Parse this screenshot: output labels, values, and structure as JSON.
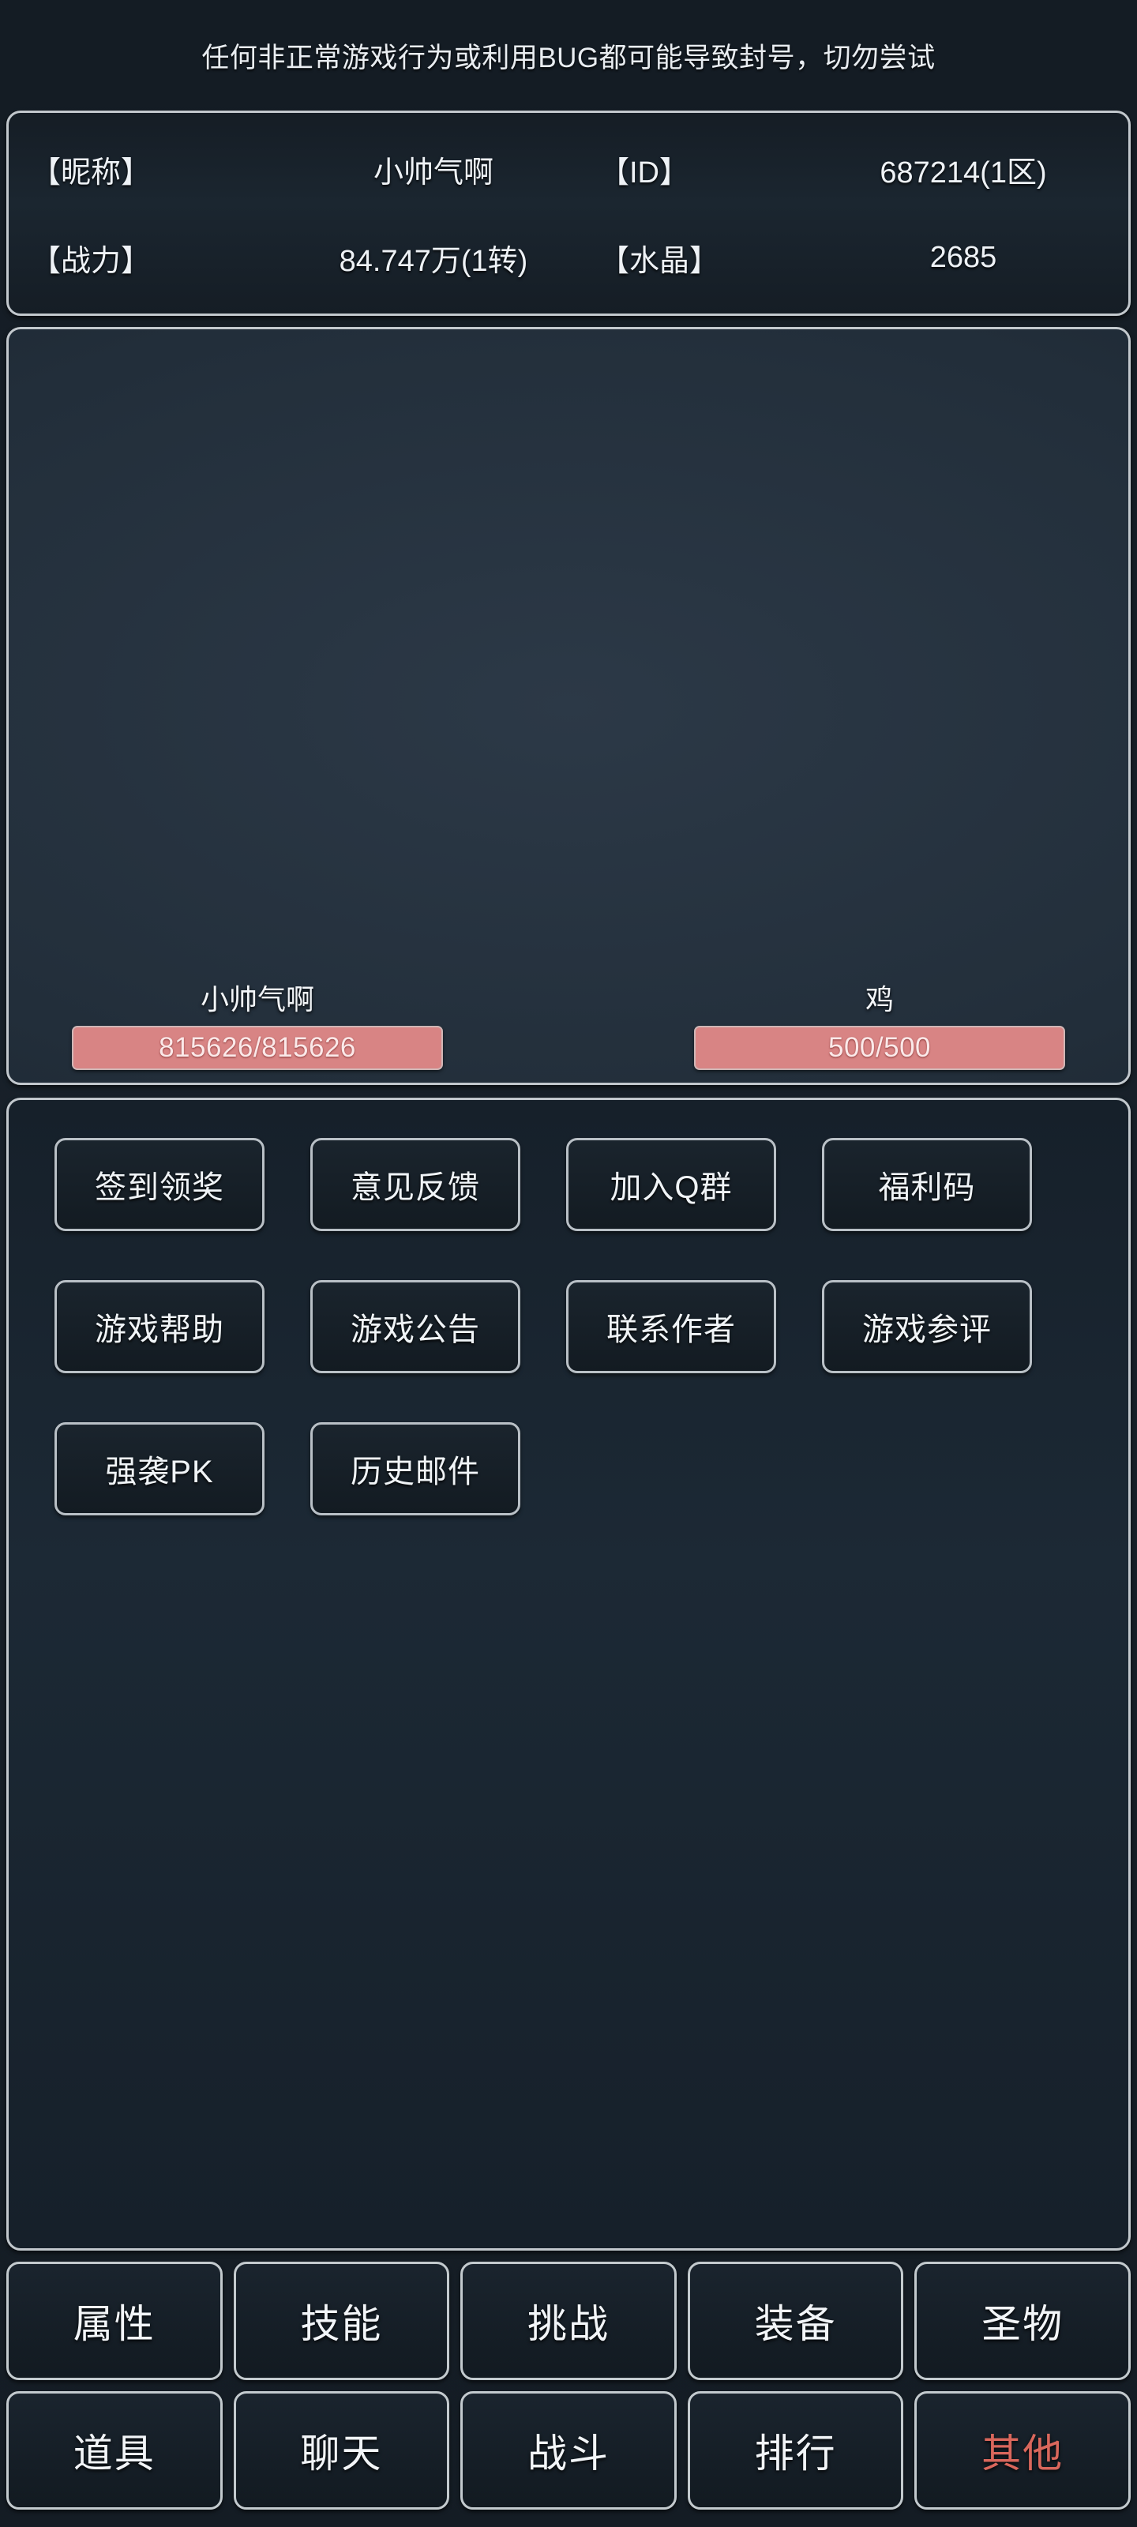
{
  "warning": {
    "text": "任何非正常游戏行为或利用BUG都可能导致封号，切勿尝试"
  },
  "player_stats": {
    "rows": [
      {
        "label_left": "【昵称】",
        "value_left": "小帅气啊",
        "label_right": "【ID】",
        "value_right": "687214(1区)"
      },
      {
        "label_left": "【战力】",
        "value_left": "84.747万(1转)",
        "label_right": "【水晶】",
        "value_right": "2685"
      }
    ]
  },
  "battle": {
    "player": {
      "name": "小帅气啊",
      "hp_text": "815626/815626",
      "hp_current": 815626,
      "hp_max": 815626,
      "hp_percent": 100
    },
    "enemy": {
      "name": "鸡",
      "hp_text": "500/500",
      "hp_current": 500,
      "hp_max": 500,
      "hp_percent": 100
    },
    "hp_bar_color": "#d88484"
  },
  "menu": {
    "buttons": [
      {
        "label": "签到领奖"
      },
      {
        "label": "意见反馈"
      },
      {
        "label": "加入Q群"
      },
      {
        "label": "福利码"
      },
      {
        "label": "游戏帮助"
      },
      {
        "label": "游戏公告"
      },
      {
        "label": "联系作者"
      },
      {
        "label": "游戏参评"
      },
      {
        "label": "强袭PK"
      },
      {
        "label": "历史邮件"
      }
    ]
  },
  "bottom_nav": {
    "active_color": "#d9675c",
    "rows": [
      [
        {
          "label": "属性",
          "active": false
        },
        {
          "label": "技能",
          "active": false
        },
        {
          "label": "挑战",
          "active": false
        },
        {
          "label": "装备",
          "active": false
        },
        {
          "label": "圣物",
          "active": false
        }
      ],
      [
        {
          "label": "道具",
          "active": false
        },
        {
          "label": "聊天",
          "active": false
        },
        {
          "label": "战斗",
          "active": false
        },
        {
          "label": "排行",
          "active": false
        },
        {
          "label": "其他",
          "active": true
        }
      ]
    ]
  }
}
